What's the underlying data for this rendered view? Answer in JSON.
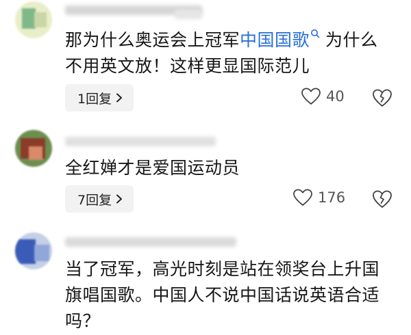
{
  "comments": [
    {
      "text_plain_1": "那为什么奥运会上冠军",
      "keyword": "中国国歌",
      "text_plain_2": "为什么",
      "text_line2": "不用英文放！这样更显国际范儿",
      "reply_label": "1回复",
      "like_count": "40",
      "avatar_colors": [
        "#c9d6a6",
        "#7fb98a",
        "#e9eec9"
      ]
    },
    {
      "text": "全红婵才是爱国运动员",
      "reply_label": "7回复",
      "like_count": "176",
      "avatar_colors": [
        "#8a3b2a",
        "#d98a6a",
        "#6d8f4e"
      ]
    },
    {
      "text_line1": "当了冠军，高光时刻是站在领奖台上升国",
      "text_line2": "旗唱国歌。中国人不说中国话说英语合适",
      "text_line3": "吗？",
      "avatar_colors": [
        "#3a5bb8",
        "#8fa7d9",
        "#c5cfe6"
      ]
    }
  ],
  "icons": {
    "like": "heart-icon",
    "dislike": "broken-heart-icon",
    "search": "search-icon",
    "chevron": "chevron-right-icon"
  },
  "colors": {
    "keyword": "#2a6fd6",
    "reply_bg": "#f2f2f2",
    "text": "#161616",
    "muted": "#555555"
  }
}
